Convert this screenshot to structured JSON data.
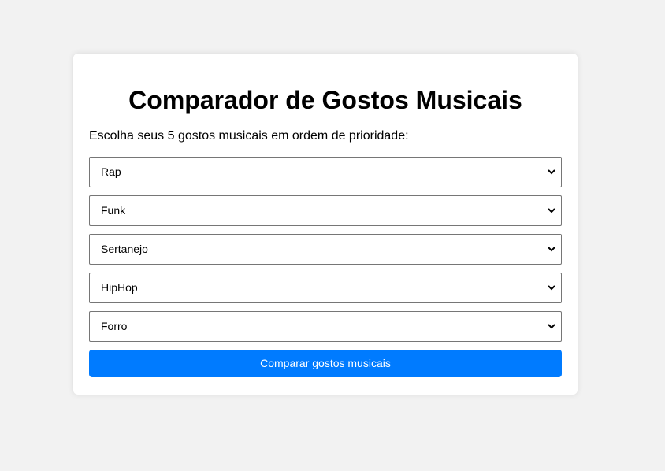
{
  "page": {
    "title": "Comparador de Gostos Musicais",
    "instruction": "Escolha seus 5 gostos musicais em ordem de prioridade:"
  },
  "selects": [
    {
      "selected": "Rap"
    },
    {
      "selected": "Funk"
    },
    {
      "selected": "Sertanejo"
    },
    {
      "selected": "HipHop"
    },
    {
      "selected": "Forro"
    }
  ],
  "button": {
    "label": "Comparar gostos musicais"
  },
  "colors": {
    "background": "#f2f2f2",
    "card": "#ffffff",
    "accent": "#007bff",
    "select_border": "#767676"
  },
  "icons": {
    "select_arrow": "chevron-down-icon"
  }
}
